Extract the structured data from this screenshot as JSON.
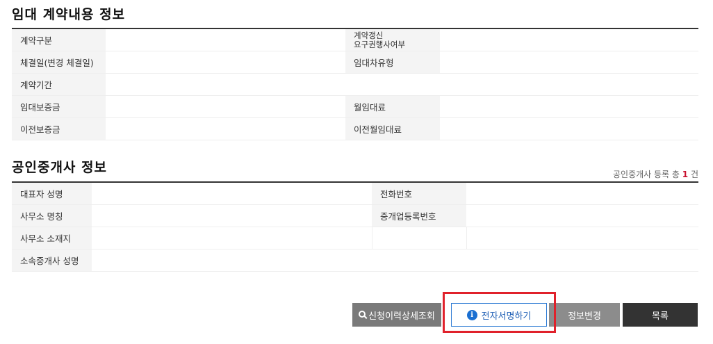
{
  "lease": {
    "title": "임대 계약내용 정보",
    "rows": [
      {
        "left_label": "계약구분",
        "right_label_line1": "계약갱신",
        "right_label_line2": "요구권행사여부"
      },
      {
        "left_label": "체결일(변경 체결일)",
        "right_label": "임대차유형"
      },
      {
        "left_label": "계약기간"
      },
      {
        "left_label": "임대보증금",
        "right_label": "월임대료"
      },
      {
        "left_label": "이전보증금",
        "right_label": "이전월임대료"
      }
    ]
  },
  "agent": {
    "title": "공인중개사 정보",
    "count_prefix": "공인중개사 등록 총",
    "count_value": "1",
    "count_suffix": "건",
    "rows": [
      {
        "left_label": "대표자 성명",
        "right_label": "전화번호"
      },
      {
        "left_label": "사무소 명칭",
        "right_label": "중개업등록번호"
      },
      {
        "left_label": "사무소 소재지"
      },
      {
        "left_label": "소속중개사 성명"
      }
    ]
  },
  "buttons": {
    "history": "신청이력상세조회",
    "sign": "전자서명하기",
    "change": "정보변경",
    "list": "목록"
  },
  "colors": {
    "highlight": "#e0212b",
    "accent": "#1a6fd1",
    "count": "#c8102e"
  }
}
